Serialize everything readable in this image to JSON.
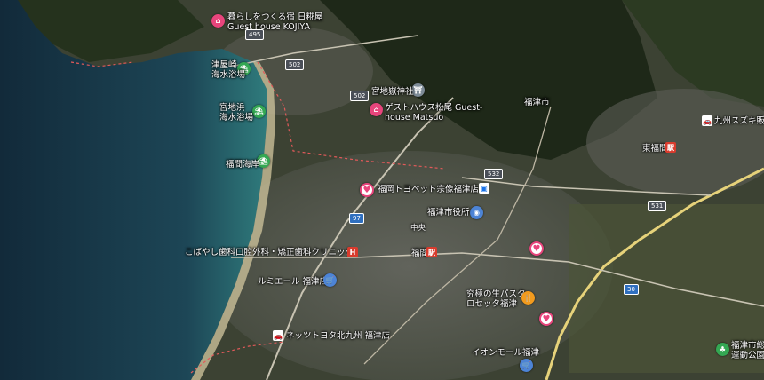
{
  "places": {
    "guesthouse_kojiya": "暮らしをつくる宿 日糀屋\nGuest house KOJIYA",
    "tsuyazaki_beach": "津屋崎\n海水浴場",
    "miyajidake_shrine": "宮地嶽神社",
    "guesthouse_matsuo": "ゲストハウス松尾 Guest-\nhouse Matsuo",
    "miyajihama_beach": "宮地浜\n海水浴場",
    "fukutsu_city": "福津市",
    "fukuma_beach": "福間海岸",
    "suzuki_dealer": "九州スズキ販",
    "higashi_fukuma": "東福間",
    "toyota_dealer": "福岡トヨペット宗像福津店",
    "fukutsu_city_hall": "福津市役所",
    "chuo": "中央",
    "fukuma_station": "福間",
    "kobayashi_clinic": "こばやし歯科口腔外科・矯正歯科クリニック",
    "lumiere": "ルミエール 福津店",
    "pasta_shop": "究極の生パスタ\nロセッタ福津",
    "netz_toyota": "ネッツトヨタ北九州 福津店",
    "aeon_mall": "イオンモール福津",
    "sports_park": "福津市総\n運動公園"
  },
  "routes": {
    "r495": "495",
    "r502a": "502",
    "r502b": "502",
    "r532": "532",
    "r97": "97",
    "r531": "531",
    "r30": "30"
  },
  "colors": {
    "sea_deep": "#163041",
    "sea_shallow": "#2c6f72",
    "land": "#3b4031",
    "forest": "#1f2a1a",
    "road": "#e6d27a",
    "pink_pin": "#e8457c",
    "green_pin": "#34a853"
  }
}
